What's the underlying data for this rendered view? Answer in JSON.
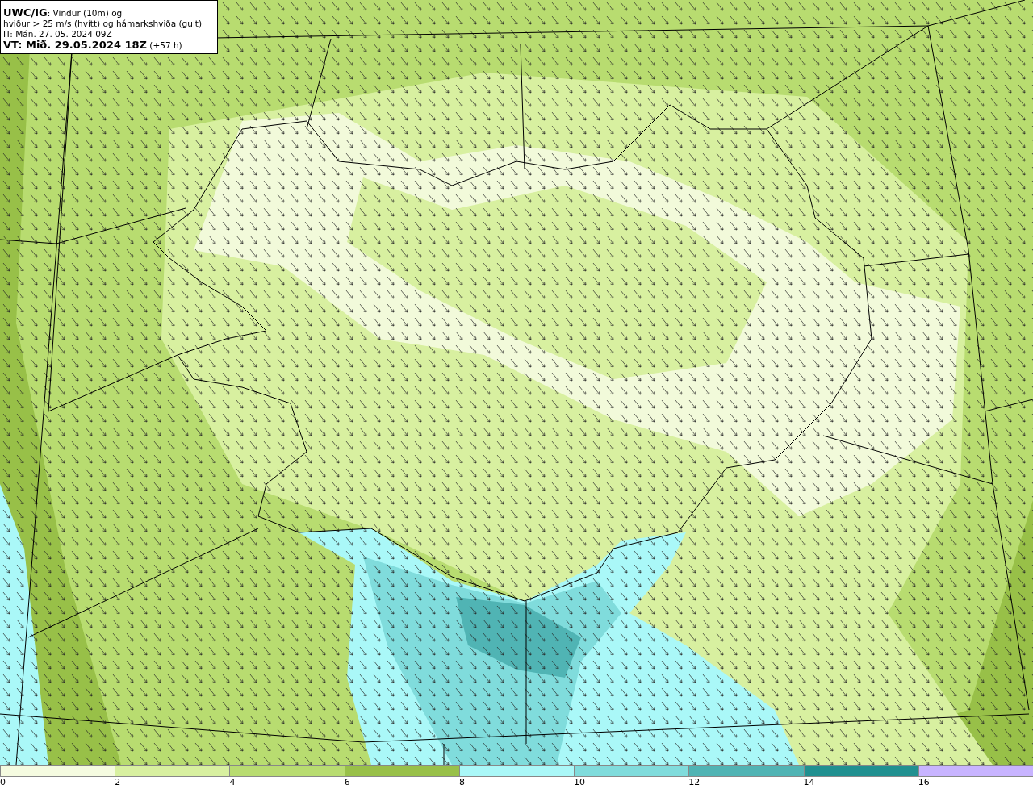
{
  "title_box": {
    "lines": [
      "**UWC/IG**: Vindur (10m) og",
      "hviður > 25 m/s (hvítt) og hámarkshviða (gult)",
      "IT: Mán. 27. 05. 2024 09Z",
      "**VT: Mið. 29.05.2024 18Z** (+57 h)"
    ]
  },
  "legend": {
    "swatches": [
      {
        "color": "#f5fbe0"
      },
      {
        "color": "#d8f0a0"
      },
      {
        "color": "#b8dc70"
      },
      {
        "color": "#98c048"
      },
      {
        "color": "#aaf8f8"
      },
      {
        "color": "#80dcdc"
      },
      {
        "color": "#50b4b4"
      },
      {
        "color": "#209090"
      },
      {
        "color": "#c8b4ff"
      }
    ],
    "labels": [
      "0",
      "2",
      "4",
      "6",
      "8",
      "10",
      "12",
      "14",
      "16"
    ]
  }
}
